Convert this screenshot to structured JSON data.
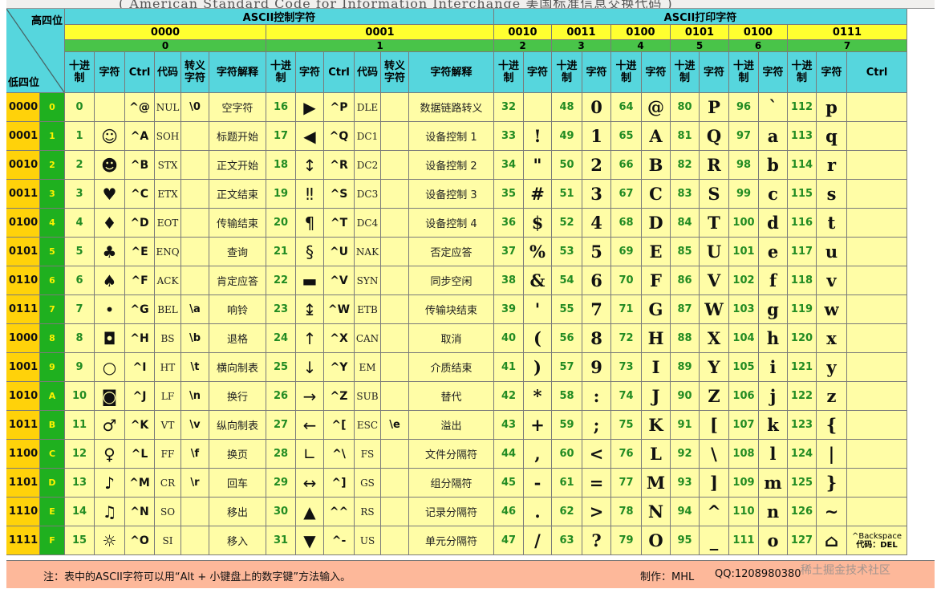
{
  "top_title": "( American Standard Code for Information Interchange  美国标准信息交换代码 )",
  "corner": {
    "high": "高四位",
    "low": "低四位"
  },
  "sections": {
    "control": "ASCII控制字符",
    "print": "ASCII打印字符"
  },
  "groups_bin": [
    "0000",
    "0001",
    "0010",
    "0011",
    "0100",
    "0101",
    "0100",
    "0111"
  ],
  "groups_hex": [
    "0",
    "1",
    "2",
    "3",
    "4",
    "5",
    "6",
    "7"
  ],
  "col_headers": {
    "dec": "十进制",
    "char": "字符",
    "ctrl": "Ctrl",
    "code": "代码",
    "esc": "转义字符",
    "desc": "字符解释"
  },
  "rows": [
    {
      "bin": "0000",
      "hex": "0",
      "c0": {
        "dec": "0",
        "sym": "",
        "ctrl": "^@",
        "code": "NUL",
        "esc": "\\0",
        "desc": "空字符"
      },
      "c1": {
        "dec": "16",
        "sym": "▶",
        "ctrl": "^P",
        "code": "DLE",
        "esc": "",
        "desc": "数据链路转义"
      },
      "p": [
        [
          "32",
          ""
        ],
        [
          "48",
          "0"
        ],
        [
          "64",
          "@"
        ],
        [
          "80",
          "P"
        ],
        [
          "96",
          "`"
        ],
        [
          "112",
          "p"
        ]
      ]
    },
    {
      "bin": "0001",
      "hex": "1",
      "c0": {
        "dec": "1",
        "sym": "☺",
        "ctrl": "^A",
        "code": "SOH",
        "esc": "",
        "desc": "标题开始"
      },
      "c1": {
        "dec": "17",
        "sym": "◀",
        "ctrl": "^Q",
        "code": "DC1",
        "esc": "",
        "desc": "设备控制 1"
      },
      "p": [
        [
          "33",
          "!"
        ],
        [
          "49",
          "1"
        ],
        [
          "65",
          "A"
        ],
        [
          "81",
          "Q"
        ],
        [
          "97",
          "a"
        ],
        [
          "113",
          "q"
        ]
      ]
    },
    {
      "bin": "0010",
      "hex": "2",
      "c0": {
        "dec": "2",
        "sym": "☻",
        "ctrl": "^B",
        "code": "STX",
        "esc": "",
        "desc": "正文开始"
      },
      "c1": {
        "dec": "18",
        "sym": "↕",
        "ctrl": "^R",
        "code": "DC2",
        "esc": "",
        "desc": "设备控制 2"
      },
      "p": [
        [
          "34",
          "\""
        ],
        [
          "50",
          "2"
        ],
        [
          "66",
          "B"
        ],
        [
          "82",
          "R"
        ],
        [
          "98",
          "b"
        ],
        [
          "114",
          "r"
        ]
      ]
    },
    {
      "bin": "0011",
      "hex": "3",
      "c0": {
        "dec": "3",
        "sym": "♥",
        "ctrl": "^C",
        "code": "ETX",
        "esc": "",
        "desc": "正文结束"
      },
      "c1": {
        "dec": "19",
        "sym": "‼",
        "ctrl": "^S",
        "code": "DC3",
        "esc": "",
        "desc": "设备控制 3"
      },
      "p": [
        [
          "35",
          "#"
        ],
        [
          "51",
          "3"
        ],
        [
          "67",
          "C"
        ],
        [
          "83",
          "S"
        ],
        [
          "99",
          "c"
        ],
        [
          "115",
          "s"
        ]
      ]
    },
    {
      "bin": "0100",
      "hex": "4",
      "c0": {
        "dec": "4",
        "sym": "♦",
        "ctrl": "^D",
        "code": "EOT",
        "esc": "",
        "desc": "传输结束"
      },
      "c1": {
        "dec": "20",
        "sym": "¶",
        "ctrl": "^T",
        "code": "DC4",
        "esc": "",
        "desc": "设备控制 4"
      },
      "p": [
        [
          "36",
          "$"
        ],
        [
          "52",
          "4"
        ],
        [
          "68",
          "D"
        ],
        [
          "84",
          "T"
        ],
        [
          "100",
          "d"
        ],
        [
          "116",
          "t"
        ]
      ]
    },
    {
      "bin": "0101",
      "hex": "5",
      "c0": {
        "dec": "5",
        "sym": "♣",
        "ctrl": "^E",
        "code": "ENQ",
        "esc": "",
        "desc": "查询"
      },
      "c1": {
        "dec": "21",
        "sym": "§",
        "ctrl": "^U",
        "code": "NAK",
        "esc": "",
        "desc": "否定应答"
      },
      "p": [
        [
          "37",
          "%"
        ],
        [
          "53",
          "5"
        ],
        [
          "69",
          "E"
        ],
        [
          "85",
          "U"
        ],
        [
          "101",
          "e"
        ],
        [
          "117",
          "u"
        ]
      ]
    },
    {
      "bin": "0110",
      "hex": "6",
      "c0": {
        "dec": "6",
        "sym": "♠",
        "ctrl": "^F",
        "code": "ACK",
        "esc": "",
        "desc": "肯定应答"
      },
      "c1": {
        "dec": "22",
        "sym": "▬",
        "ctrl": "^V",
        "code": "SYN",
        "esc": "",
        "desc": "同步空闲"
      },
      "p": [
        [
          "38",
          "&"
        ],
        [
          "54",
          "6"
        ],
        [
          "70",
          "F"
        ],
        [
          "86",
          "V"
        ],
        [
          "102",
          "f"
        ],
        [
          "118",
          "v"
        ]
      ]
    },
    {
      "bin": "0111",
      "hex": "7",
      "c0": {
        "dec": "7",
        "sym": "•",
        "ctrl": "^G",
        "code": "BEL",
        "esc": "\\a",
        "desc": "响铃"
      },
      "c1": {
        "dec": "23",
        "sym": "↨",
        "ctrl": "^W",
        "code": "ETB",
        "esc": "",
        "desc": "传输块结束"
      },
      "p": [
        [
          "39",
          "'"
        ],
        [
          "55",
          "7"
        ],
        [
          "71",
          "G"
        ],
        [
          "87",
          "W"
        ],
        [
          "103",
          "g"
        ],
        [
          "119",
          "w"
        ]
      ]
    },
    {
      "bin": "1000",
      "hex": "8",
      "c0": {
        "dec": "8",
        "sym": "◘",
        "ctrl": "^H",
        "code": "BS",
        "esc": "\\b",
        "desc": "退格"
      },
      "c1": {
        "dec": "24",
        "sym": "↑",
        "ctrl": "^X",
        "code": "CAN",
        "esc": "",
        "desc": "取消"
      },
      "p": [
        [
          "40",
          "("
        ],
        [
          "56",
          "8"
        ],
        [
          "72",
          "H"
        ],
        [
          "88",
          "X"
        ],
        [
          "104",
          "h"
        ],
        [
          "120",
          "x"
        ]
      ]
    },
    {
      "bin": "1001",
      "hex": "9",
      "c0": {
        "dec": "9",
        "sym": "○",
        "ctrl": "^I",
        "code": "HT",
        "esc": "\\t",
        "desc": "横向制表"
      },
      "c1": {
        "dec": "25",
        "sym": "↓",
        "ctrl": "^Y",
        "code": "EM",
        "esc": "",
        "desc": "介质结束"
      },
      "p": [
        [
          "41",
          ")"
        ],
        [
          "57",
          "9"
        ],
        [
          "73",
          "I"
        ],
        [
          "89",
          "Y"
        ],
        [
          "105",
          "i"
        ],
        [
          "121",
          "y"
        ]
      ]
    },
    {
      "bin": "1010",
      "hex": "A",
      "c0": {
        "dec": "10",
        "sym": "◙",
        "ctrl": "^J",
        "code": "LF",
        "esc": "\\n",
        "desc": "换行"
      },
      "c1": {
        "dec": "26",
        "sym": "→",
        "ctrl": "^Z",
        "code": "SUB",
        "esc": "",
        "desc": "替代"
      },
      "p": [
        [
          "42",
          "*"
        ],
        [
          "58",
          ":"
        ],
        [
          "74",
          "J"
        ],
        [
          "90",
          "Z"
        ],
        [
          "106",
          "j"
        ],
        [
          "122",
          "z"
        ]
      ]
    },
    {
      "bin": "1011",
      "hex": "B",
      "c0": {
        "dec": "11",
        "sym": "♂",
        "ctrl": "^K",
        "code": "VT",
        "esc": "\\v",
        "desc": "纵向制表"
      },
      "c1": {
        "dec": "27",
        "sym": "←",
        "ctrl": "^[",
        "code": "ESC",
        "esc": "\\e",
        "desc": "溢出"
      },
      "p": [
        [
          "43",
          "+"
        ],
        [
          "59",
          ";"
        ],
        [
          "75",
          "K"
        ],
        [
          "91",
          "["
        ],
        [
          "107",
          "k"
        ],
        [
          "123",
          "{"
        ]
      ]
    },
    {
      "bin": "1100",
      "hex": "C",
      "c0": {
        "dec": "12",
        "sym": "♀",
        "ctrl": "^L",
        "code": "FF",
        "esc": "\\f",
        "desc": "换页"
      },
      "c1": {
        "dec": "28",
        "sym": "∟",
        "ctrl": "^\\",
        "code": "FS",
        "esc": "",
        "desc": "文件分隔符"
      },
      "p": [
        [
          "44",
          ","
        ],
        [
          "60",
          "<"
        ],
        [
          "76",
          "L"
        ],
        [
          "92",
          "\\"
        ],
        [
          "108",
          "l"
        ],
        [
          "124",
          "|"
        ]
      ]
    },
    {
      "bin": "1101",
      "hex": "D",
      "c0": {
        "dec": "13",
        "sym": "♪",
        "ctrl": "^M",
        "code": "CR",
        "esc": "\\r",
        "desc": "回车"
      },
      "c1": {
        "dec": "29",
        "sym": "↔",
        "ctrl": "^]",
        "code": "GS",
        "esc": "",
        "desc": "组分隔符"
      },
      "p": [
        [
          "45",
          "-"
        ],
        [
          "61",
          "="
        ],
        [
          "77",
          "M"
        ],
        [
          "93",
          "]"
        ],
        [
          "109",
          "m"
        ],
        [
          "125",
          "}"
        ]
      ]
    },
    {
      "bin": "1110",
      "hex": "E",
      "c0": {
        "dec": "14",
        "sym": "♫",
        "ctrl": "^N",
        "code": "SO",
        "esc": "",
        "desc": "移出"
      },
      "c1": {
        "dec": "30",
        "sym": "▲",
        "ctrl": "^^",
        "code": "RS",
        "esc": "",
        "desc": "记录分隔符"
      },
      "p": [
        [
          "46",
          "."
        ],
        [
          "62",
          ">"
        ],
        [
          "78",
          "N"
        ],
        [
          "94",
          "^"
        ],
        [
          "110",
          "n"
        ],
        [
          "126",
          "~"
        ]
      ]
    },
    {
      "bin": "1111",
      "hex": "F",
      "c0": {
        "dec": "15",
        "sym": "☼",
        "ctrl": "^O",
        "code": "SI",
        "esc": "",
        "desc": "移入"
      },
      "c1": {
        "dec": "31",
        "sym": "▼",
        "ctrl": "^-",
        "code": "US",
        "esc": "",
        "desc": "单元分隔符"
      },
      "p": [
        [
          "47",
          "/"
        ],
        [
          "63",
          "?"
        ],
        [
          "79",
          "O"
        ],
        [
          "95",
          "_"
        ],
        [
          "111",
          "o"
        ],
        [
          "127",
          "⌂"
        ]
      ]
    }
  ],
  "last_ctrl": {
    "backspace": "^Backspace",
    "code_label": "代码：DEL"
  },
  "footer": {
    "note": "注：表中的ASCII字符可以用“Alt + 小键盘上的数字键”方法输入。",
    "author": "制作：MHL",
    "qq": "QQ:1208980380",
    "watermark": "稀土掘金技术社区"
  },
  "colors": {
    "header": "#56d6dd",
    "group": "#ffff30",
    "hex_green": "#1fb01f",
    "body": "#fffda6",
    "footer": "#fdb89a"
  }
}
